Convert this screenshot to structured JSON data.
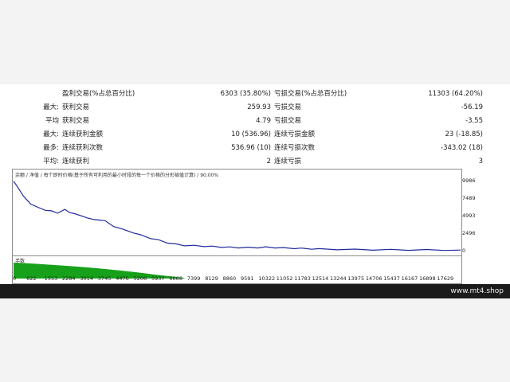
{
  "stats": {
    "rows": [
      {
        "label1": "",
        "text1": "盈利交易(%占总百分比)",
        "value1": "6303 (35.80%)",
        "text2": "亏损交易(%占总百分比)",
        "value2": "11303 (64.20%)"
      },
      {
        "label1": "最大:",
        "text1": "获利交易",
        "value1": "259.93",
        "text2": "亏损交易",
        "value2": "-56.19"
      },
      {
        "label1": "平均",
        "text1": "获利交易",
        "value1": "4.79",
        "text2": "亏损交易",
        "value2": "-3.55"
      },
      {
        "label1": "最大:",
        "text1": "连续获利金额",
        "value1": "10 (536.96)",
        "text2": "连续亏损金额",
        "value2": "23 (-18.85)"
      },
      {
        "label1": "最多:",
        "text1": "连续获利次数",
        "value1": "536.96 (10)",
        "text2": "连续亏损次数",
        "value2": "-343.02 (18)"
      },
      {
        "label1": "平均:",
        "text1": "连续获利",
        "value1": "2",
        "text2": "连续亏损",
        "value2": "3"
      }
    ]
  },
  "chart": {
    "caption": "余额 / 净值 / 每个即时价格(基于所有可利用的最小时段的每一个价格的分形插值计算) / 90.00%",
    "volume_caption": "手数"
  },
  "chart_data": {
    "type": "line",
    "x_ticks": [
      "0",
      "822",
      "1553",
      "2284",
      "3014",
      "3745",
      "4476",
      "5206",
      "5937",
      "6668",
      "7399",
      "8129",
      "8860",
      "9591",
      "10322",
      "11052",
      "11783",
      "12514",
      "13244",
      "13975",
      "14706",
      "15437",
      "16167",
      "16898",
      "17629"
    ],
    "y_ticks": [
      "9986",
      "7489",
      "4993",
      "2496",
      "0"
    ],
    "ylim": [
      0,
      10500
    ],
    "xlim": [
      0,
      18300
    ],
    "series": [
      {
        "color": "#1f2a9c",
        "x": [
          0,
          150,
          400,
          700,
          1000,
          1300,
          1553,
          1800,
          2100,
          2284,
          2500,
          2800,
          3014,
          3300,
          3745,
          4100,
          4476,
          4900,
          5206,
          5600,
          5937,
          6300,
          6668,
          7000,
          7399,
          7800,
          8129,
          8500,
          8860,
          9200,
          9591,
          10000,
          10322,
          10700,
          11052,
          11500,
          11783,
          12200,
          12514,
          13244,
          13975,
          14706,
          15437,
          16167,
          16898,
          17629,
          18300
        ],
        "y": [
          9986,
          9300,
          7800,
          6800,
          6200,
          5900,
          5700,
          5500,
          5900,
          5600,
          5300,
          5100,
          4700,
          4600,
          4300,
          3600,
          3100,
          2700,
          2300,
          1900,
          1600,
          1250,
          1000,
          870,
          810,
          760,
          700,
          640,
          590,
          560,
          540,
          560,
          600,
          560,
          490,
          460,
          420,
          380,
          340,
          300,
          270,
          250,
          240,
          230,
          220,
          210,
          200
        ]
      }
    ],
    "volume": {
      "color": "#17a11a",
      "x": [
        0,
        500,
        1000,
        1553,
        2284,
        3014,
        3745,
        4476,
        5206,
        5937,
        6668,
        7000
      ],
      "y": [
        10,
        9.6,
        9.2,
        8.6,
        7.9,
        7.0,
        6.0,
        4.9,
        3.6,
        2.2,
        1.0,
        0.4
      ],
      "ylim": [
        0,
        12
      ],
      "xlim": [
        0,
        18300
      ]
    }
  },
  "footer": {
    "text": "www.mt4.shop"
  }
}
